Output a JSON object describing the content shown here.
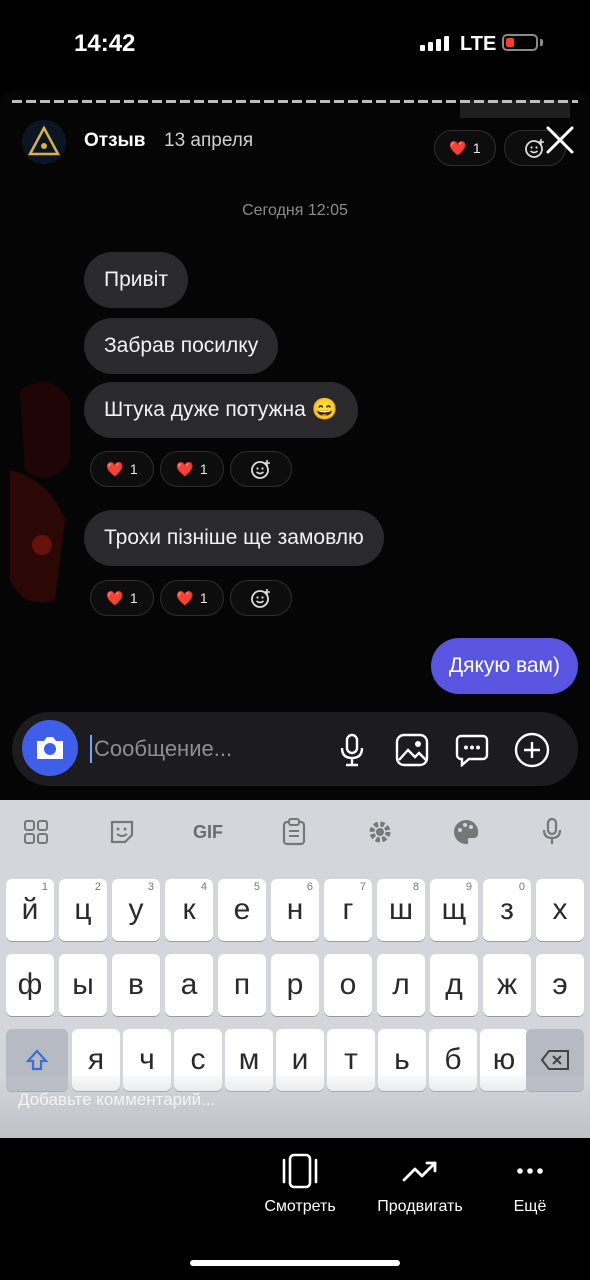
{
  "status_bar": {
    "time": "14:42",
    "network": "LTE"
  },
  "story": {
    "name": "Отзыв",
    "date": "13 апреля",
    "header_reaction": {
      "emoji": "❤️",
      "count": "1"
    }
  },
  "chat": {
    "timestamp": "Сегодня 12:05",
    "messages": [
      {
        "text": "Привіт"
      },
      {
        "text": "Забрав посилку"
      },
      {
        "text": "Штука дуже потужна 😄"
      },
      {
        "text": "Трохи пізніше ще замовлю"
      }
    ],
    "reaction_rows": [
      {
        "hearts": [
          {
            "emoji": "❤️",
            "count": "1"
          },
          {
            "emoji": "❤️",
            "count": "1"
          }
        ]
      },
      {
        "hearts": [
          {
            "emoji": "❤️",
            "count": "1"
          },
          {
            "emoji": "❤️",
            "count": "1"
          }
        ]
      }
    ],
    "outgoing": {
      "text": "Дякую вам)"
    }
  },
  "composer": {
    "placeholder": "Сообщение..."
  },
  "keyboard": {
    "gif_label": "GIF",
    "row1": [
      {
        "k": "й",
        "h": "1"
      },
      {
        "k": "ц",
        "h": "2"
      },
      {
        "k": "у",
        "h": "3"
      },
      {
        "k": "к",
        "h": "4"
      },
      {
        "k": "е",
        "h": "5"
      },
      {
        "k": "н",
        "h": "6"
      },
      {
        "k": "г",
        "h": "7"
      },
      {
        "k": "ш",
        "h": "8"
      },
      {
        "k": "щ",
        "h": "9"
      },
      {
        "k": "з",
        "h": "0"
      },
      {
        "k": "х",
        "h": ""
      }
    ],
    "row2": [
      "ф",
      "ы",
      "в",
      "а",
      "п",
      "р",
      "о",
      "л",
      "д",
      "ж",
      "э"
    ],
    "row3": [
      "я",
      "ч",
      "с",
      "м",
      "и",
      "т",
      "ь",
      "б",
      "ю"
    ],
    "comment_placeholder": "Добавьте комментарий..."
  },
  "actions": [
    {
      "label": "Смотреть",
      "icon": "view-icon"
    },
    {
      "label": "Продвигать",
      "icon": "trend-up-icon"
    },
    {
      "label": "Ещё",
      "icon": "more-icon"
    }
  ],
  "colors": {
    "outgoing_bubble": "#5a55e0",
    "camera_button": "#3f5fe8",
    "heart": "#e53945"
  }
}
